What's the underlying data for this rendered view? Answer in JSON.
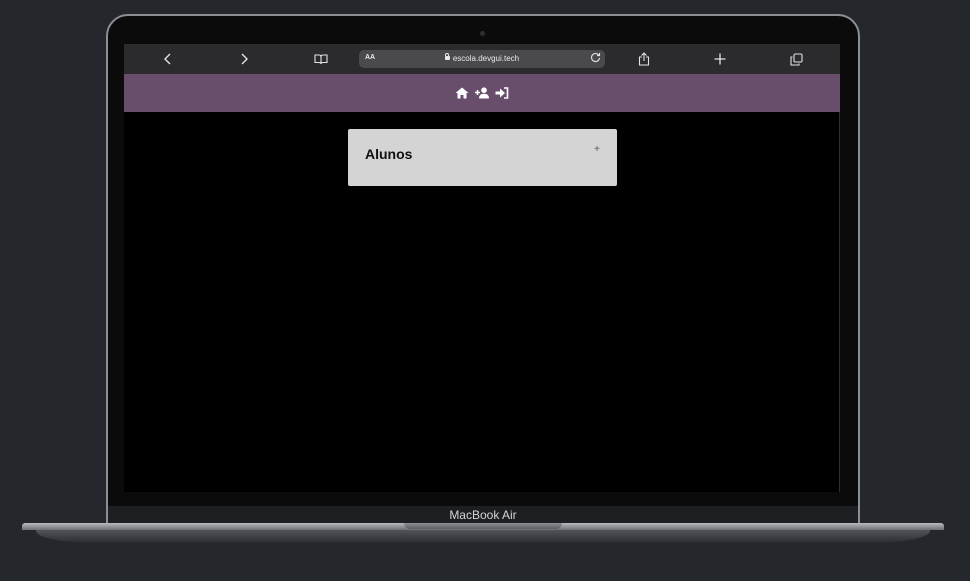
{
  "browser": {
    "aa_label": "AA",
    "url": "escola.devgui.tech"
  },
  "nav": {
    "icons": [
      "home-icon",
      "add-user-icon",
      "sign-in-icon"
    ]
  },
  "card": {
    "title": "Alunos",
    "add_label": "+"
  },
  "device": {
    "label": "MacBook Air"
  },
  "colors": {
    "nav_bg": "#684e6b",
    "card_bg": "#d4d4d4",
    "page_bg": "#000000",
    "browser_bar": "#2b2b2d"
  }
}
